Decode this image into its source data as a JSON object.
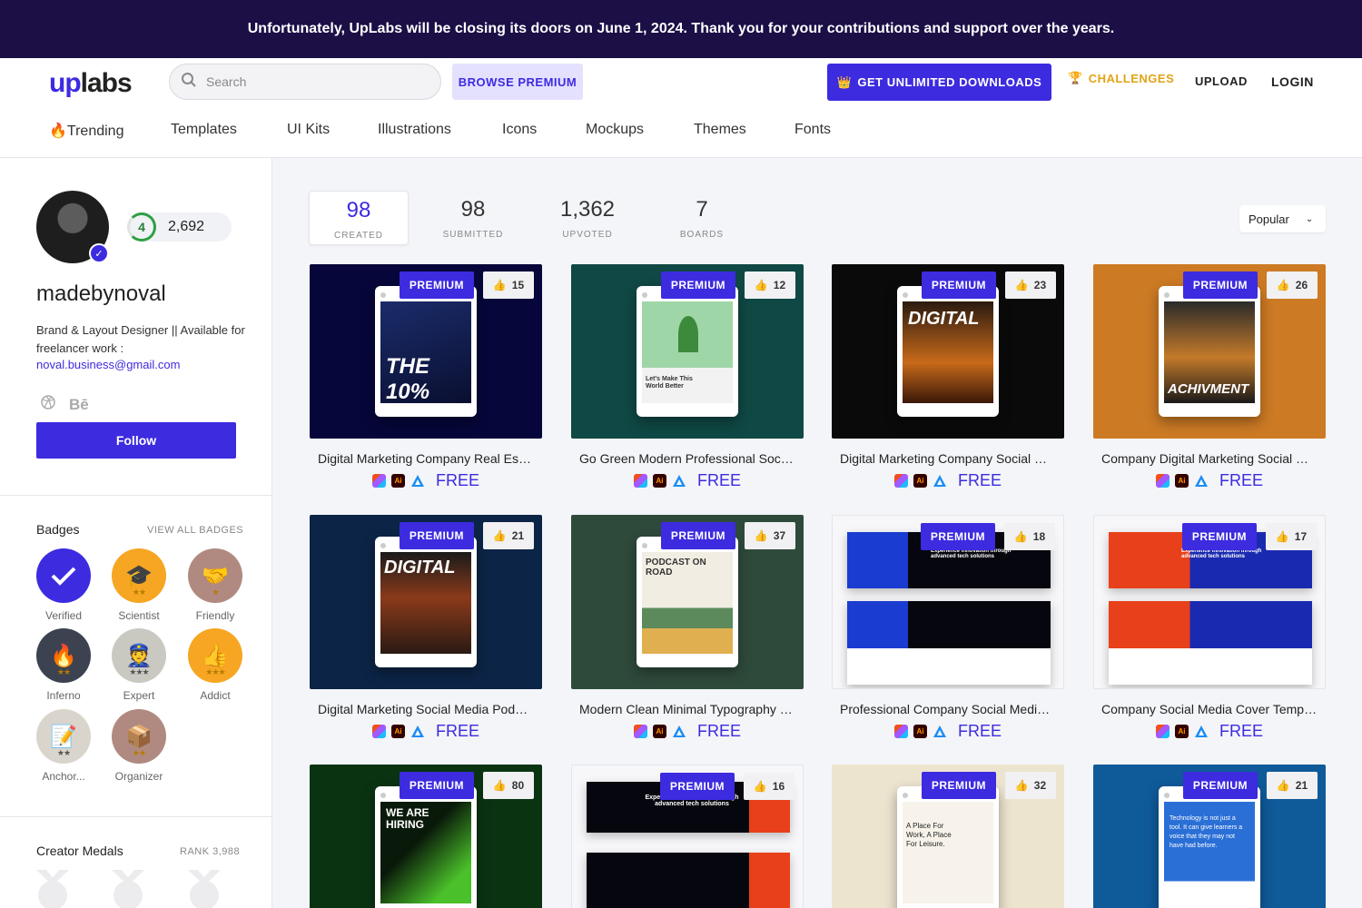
{
  "banner": {
    "text": "Unfortunately, UpLabs will be closing its doors on June 1, 2024. Thank you for your contributions and support over the years."
  },
  "header": {
    "logo_up": "up",
    "logo_labs": "labs",
    "search_placeholder": "Search",
    "browse_premium": "BROWSE PREMIUM",
    "get_unlimited": "GET UNLIMITED DOWNLOADS",
    "challenges": "CHALLENGES",
    "upload": "UPLOAD",
    "login": "LOGIN"
  },
  "nav": [
    {
      "label": "🔥Trending"
    },
    {
      "label": "Templates"
    },
    {
      "label": "UI Kits"
    },
    {
      "label": "Illustrations"
    },
    {
      "label": "Icons"
    },
    {
      "label": "Mockups"
    },
    {
      "label": "Themes"
    },
    {
      "label": "Fonts"
    }
  ],
  "profile": {
    "level": "4",
    "points": "2,692",
    "username": "madebynoval",
    "bio": "Brand & Layout Designer || Available for freelancer work :",
    "email": "noval.business@gmail.com",
    "behance": "Bē",
    "follow": "Follow"
  },
  "badges": {
    "title": "Badges",
    "view_all": "VIEW ALL BADGES",
    "items": [
      {
        "label": "Verified",
        "icon": "check-icon",
        "color": "#3d2be0",
        "stars": ""
      },
      {
        "label": "Scientist",
        "icon": "graduation-cap-icon",
        "color": "#f6a623",
        "stars": "★★"
      },
      {
        "label": "Friendly",
        "icon": "handshake-icon",
        "color": "#b08a80",
        "stars": "★"
      },
      {
        "label": "Inferno",
        "icon": "flame-icon",
        "color": "#3d4250",
        "stars": "★★"
      },
      {
        "label": "Expert",
        "icon": "expert-icon",
        "color": "#c9c9c2",
        "stars": "★★★"
      },
      {
        "label": "Addict",
        "icon": "thumbs-up-icon",
        "color": "#f6a623",
        "stars": "★★★"
      },
      {
        "label": "Anchor...",
        "icon": "notepad-icon",
        "color": "#d9d5cc",
        "stars": "★★"
      },
      {
        "label": "Organizer",
        "icon": "box-icon",
        "color": "#b08a80",
        "stars": "★★"
      }
    ]
  },
  "medals": {
    "title": "Creator Medals",
    "rank": "RANK 3,988"
  },
  "stats": [
    {
      "value": "98",
      "label": "CREATED"
    },
    {
      "value": "98",
      "label": "SUBMITTED"
    },
    {
      "value": "1,362",
      "label": "UPVOTED"
    },
    {
      "value": "7",
      "label": "BOARDS"
    }
  ],
  "sort": {
    "selected": "Popular"
  },
  "premium_label": "PREMIUM",
  "free_label": "FREE",
  "cards": [
    {
      "title": "Digital Marketing Company Real Estate Social Media Post",
      "likes": "15",
      "bg": "#06063a",
      "art": "THE 10%"
    },
    {
      "title": "Go Green Modern Professional Social Media Post",
      "likes": "12",
      "bg": "#0f4844",
      "art": "Let's Make This World Better"
    },
    {
      "title": "Digital Marketing Company Social Media Post",
      "likes": "23",
      "bg": "#0a0a0a",
      "art": "DIGITAL"
    },
    {
      "title": "Company Digital Marketing Social Media Post",
      "likes": "26",
      "bg": "#cc7a24",
      "art": "ACHIVMENT"
    },
    {
      "title": "Digital Marketing Social Media Podcast Post",
      "likes": "21",
      "bg": "#0c2446",
      "art": "DIGITAL"
    },
    {
      "title": "Modern Clean Minimal Typography Podcast Post",
      "likes": "37",
      "bg": "#2e4a3b",
      "art": "PODCAST ON ROAD"
    },
    {
      "title": "Professional Company Social Media Cover Template",
      "likes": "18",
      "bg": "#f7f7f9",
      "art": "Experience innovation through advanced tech solutions"
    },
    {
      "title": "Company Social Media Cover Template",
      "likes": "17",
      "bg": "#f7f7f9",
      "art": "Experience innovation through advanced tech solutions"
    },
    {
      "title": "",
      "likes": "80",
      "bg": "#0a3312",
      "art": "WE ARE HIRING"
    },
    {
      "title": "",
      "likes": "16",
      "bg": "#f7f7f9",
      "art": "Experience innovation through advanced tech solutions"
    },
    {
      "title": "",
      "likes": "32",
      "bg": "#ece4cf",
      "art": "A Place For Work, A Place For Leisure."
    },
    {
      "title": "",
      "likes": "21",
      "bg": "#0f5a99",
      "art": "Technology is not just a tool. It can give learners a voice that they may not have had before."
    }
  ]
}
